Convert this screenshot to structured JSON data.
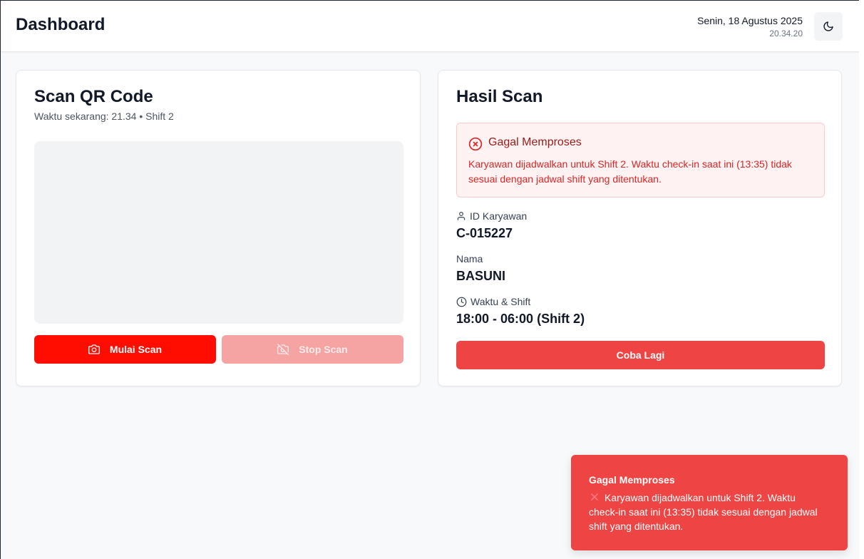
{
  "header": {
    "title": "Dashboard",
    "date": "Senin, 18 Agustus 2025",
    "time": "20.34.20",
    "theme_toggle_icon": "moon-icon"
  },
  "scanner": {
    "title": "Scan QR Code",
    "subtitle": "Waktu sekarang: 21.34 • Shift 2",
    "start_label": "Mulai Scan",
    "start_icon": "camera-icon",
    "stop_label": "Stop Scan",
    "stop_icon": "camera-off-icon"
  },
  "result": {
    "title": "Hasil Scan",
    "alert": {
      "title": "Gagal Memproses",
      "icon": "x-circle-icon",
      "message": "Karyawan dijadwalkan untuk Shift 2. Waktu check-in saat ini (13:35) tidak sesuai dengan jadwal shift yang ditentukan."
    },
    "fields": [
      {
        "label": "ID Karyawan",
        "value": "C-015227",
        "icon": "user-icon"
      },
      {
        "label": "Nama",
        "value": "BASUNI",
        "icon": ""
      },
      {
        "label": "Waktu & Shift",
        "value": "18:00 - 06:00 (Shift 2)",
        "icon": "clock-icon"
      }
    ],
    "retry_label": "Coba Lagi"
  },
  "toast": {
    "title": "Gagal Memproses",
    "icon": "x-icon",
    "message": "Karyawan dijadwalkan untuk Shift 2. Waktu check-in saat ini (13:35) tidak sesuai dengan jadwal shift yang ditentukan."
  },
  "colors": {
    "primary_red": "#fe0d00",
    "danger": "#ef4444",
    "alert_bg": "#fef2f2",
    "alert_text": "#dc2626"
  }
}
